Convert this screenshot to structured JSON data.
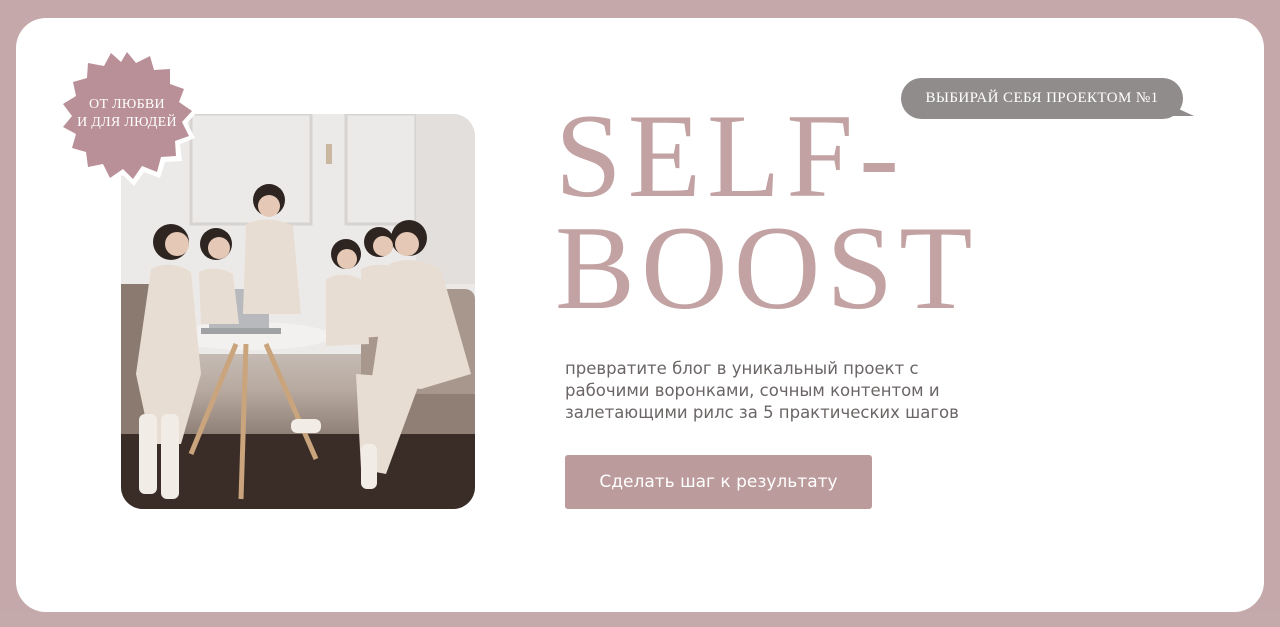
{
  "badge": {
    "line1": "ОТ ЛЮБВИ",
    "line2": "И ДЛЯ ЛЮДЕЙ"
  },
  "speech_bubble": {
    "text": "ВЫБИРАЙ СЕБЯ ПРОЕКТОМ №1"
  },
  "hero": {
    "title_line1": "SELF-",
    "title_line2": "BOOST",
    "subtitle": "превратите блог в уникальный проект с рабочими воронками, сочным контентом и залетающими рилс за 5 практических шагов",
    "cta_label": "Сделать шаг к результату"
  },
  "colors": {
    "background": "#c5a9aa",
    "card": "#ffffff",
    "accent": "#c2a2a2",
    "button": "#bb9b9b",
    "bubble": "#8f8c8b",
    "badge": "#b98f98"
  },
  "photo": {
    "icon": "group-photo-icon"
  }
}
